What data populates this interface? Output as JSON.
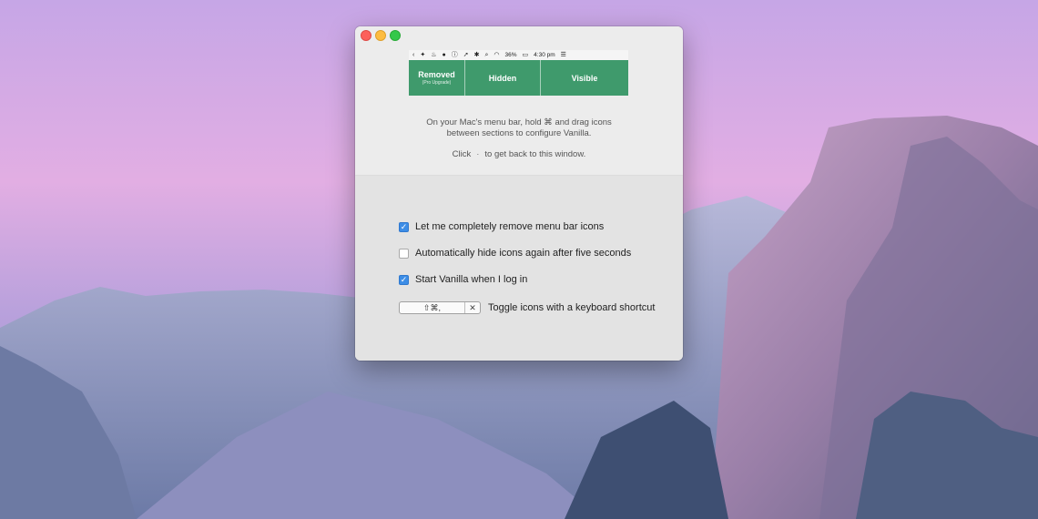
{
  "menubar": {
    "icons": [
      {
        "name": "chevron-left-icon",
        "glyph": "‹"
      },
      {
        "name": "dropbox-icon",
        "glyph": "✦"
      },
      {
        "name": "flame-icon",
        "glyph": "♨"
      },
      {
        "name": "globe-icon",
        "glyph": "●"
      },
      {
        "name": "info-icon",
        "glyph": "ⓘ"
      },
      {
        "name": "rocket-icon",
        "glyph": "➚"
      },
      {
        "name": "bluetooth-icon",
        "glyph": "✱"
      },
      {
        "name": "search-icon",
        "glyph": "⌕"
      },
      {
        "name": "wifi-icon",
        "glyph": "◠"
      }
    ],
    "battery_percent": "36%",
    "battery_icon": "▭",
    "time": "4:30 pm",
    "list_icon": "☰"
  },
  "sections": {
    "removed": {
      "label": "Removed",
      "sub": "(Pro Upgrade)"
    },
    "hidden": {
      "label": "Hidden"
    },
    "visible": {
      "label": "Visible"
    },
    "color": "#3f9a6c"
  },
  "instructions": {
    "line1": "On your Mac's menu bar, hold ⌘ and drag icons",
    "line2": "between sections to configure Vanilla.",
    "click_before": "Click",
    "click_dot": "·",
    "click_after": "to get back to this window."
  },
  "options": {
    "remove_icons": {
      "label": "Let me completely remove menu bar icons",
      "checked": true
    },
    "auto_hide": {
      "label": "Automatically hide icons again after five seconds",
      "checked": false
    },
    "start_login": {
      "label": "Start Vanilla when I log in",
      "checked": true
    }
  },
  "shortcut": {
    "value": "⇧⌘,",
    "clear_icon": "✕",
    "label": "Toggle icons with a keyboard shortcut"
  },
  "colors": {
    "accent": "#3d8de6",
    "close": "#fc605b",
    "minimize": "#fdbc40",
    "zoom": "#34c84a"
  }
}
